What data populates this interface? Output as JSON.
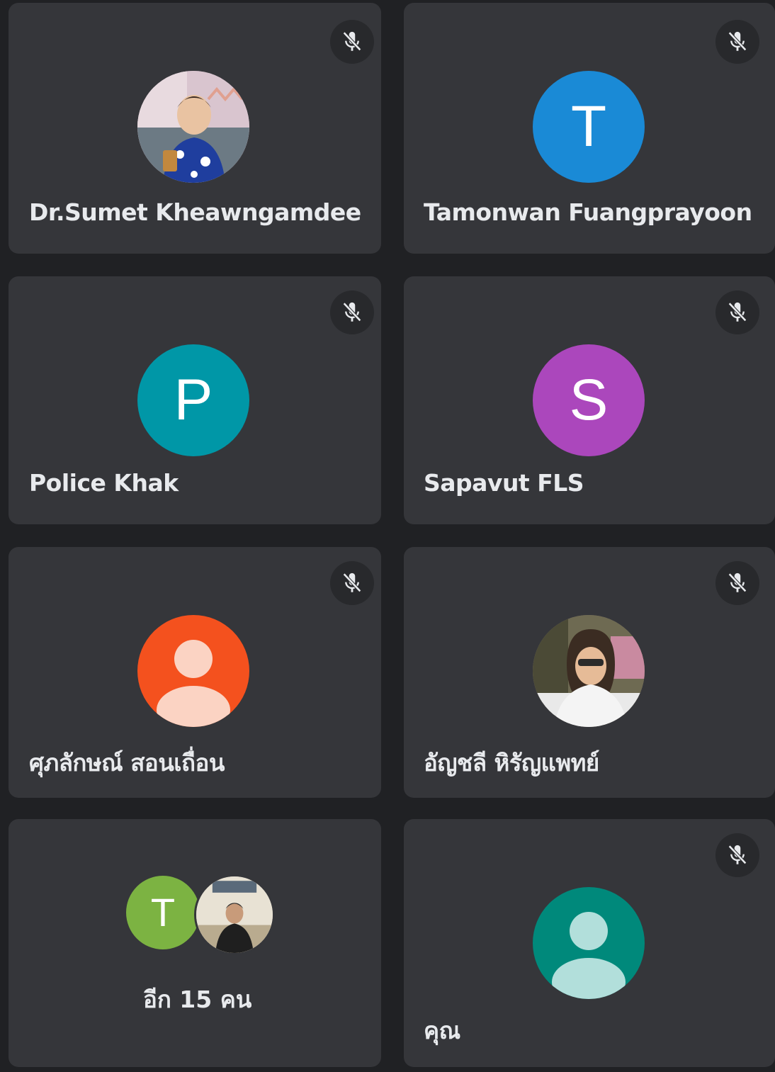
{
  "participants": [
    {
      "name": "Dr.Sumet Kheawngamdee",
      "muted": true,
      "avatar": {
        "kind": "photo",
        "icon": "person-photo-icon"
      }
    },
    {
      "name": "Tamonwan Fuangprayoon",
      "muted": true,
      "avatar": {
        "kind": "initial",
        "initial": "T",
        "color": "#1a8ad6"
      }
    },
    {
      "name": "Police Khak",
      "muted": true,
      "avatar": {
        "kind": "initial",
        "initial": "P",
        "color": "#0097a7"
      }
    },
    {
      "name": "Sapavut FLS",
      "muted": true,
      "avatar": {
        "kind": "initial",
        "initial": "S",
        "color": "#ab47bc"
      }
    },
    {
      "name": "ศุภลักษณ์ สอนเถื่อน",
      "muted": true,
      "avatar": {
        "kind": "silhouette",
        "color": "#f4511e",
        "figure_color": "#fbd3c3"
      }
    },
    {
      "name": "อัญชลี หิรัญแพทย์",
      "muted": true,
      "avatar": {
        "kind": "photo",
        "icon": "person-photo-icon"
      }
    },
    {
      "name": "คุณ",
      "muted": true,
      "avatar": {
        "kind": "silhouette",
        "color": "#00897b",
        "figure_color": "#b2dfdb"
      }
    }
  ],
  "others": {
    "label": "อีก 15 คน",
    "avatars": [
      {
        "kind": "initial",
        "initial": "T",
        "color": "#7cb342"
      },
      {
        "kind": "photo",
        "icon": "person-photo-icon"
      }
    ]
  },
  "icons": {
    "mute": "mic-off-icon"
  },
  "colors": {
    "background": "#202124",
    "tile": "#35363a",
    "text": "#e8eaed"
  }
}
